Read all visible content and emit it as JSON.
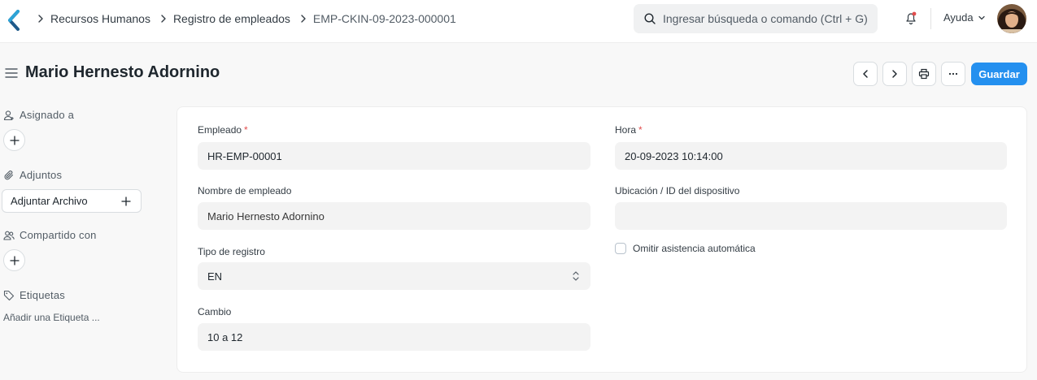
{
  "breadcrumbs": [
    "Recursos Humanos",
    "Registro de empleados",
    "EMP-CKIN-09-2023-000001"
  ],
  "search": {
    "placeholder": "Ingresar búsqueda o comando (Ctrl + G)"
  },
  "help_label": "Ayuda",
  "page": {
    "title": "Mario Hernesto Adornino",
    "save_label": "Guardar"
  },
  "sidebar": {
    "assigned_label": "Asignado a",
    "attachments_label": "Adjuntos",
    "attach_button": "Adjuntar Archivo",
    "shared_label": "Compartido con",
    "tags_label": "Etiquetas",
    "add_tag": "Añadir una Etiqueta ..."
  },
  "form": {
    "employee": {
      "label": "Empleado",
      "value": "HR-EMP-00001"
    },
    "employee_name": {
      "label": "Nombre de empleado",
      "value": "Mario Hernesto Adornino"
    },
    "log_type": {
      "label": "Tipo de registro",
      "value": "EN"
    },
    "shift": {
      "label": "Cambio",
      "value": "10 a 12"
    },
    "time": {
      "label": "Hora",
      "value": "20-09-2023 10:14:00"
    },
    "location": {
      "label": "Ubicación / ID del dispositivo",
      "value": ""
    },
    "skip_auto_attendance": {
      "label": "Omitir asistencia automática",
      "checked": false
    }
  },
  "colors": {
    "primary": "#2490ef",
    "required": "#e24c4c",
    "logo": "#1f5a8a"
  }
}
